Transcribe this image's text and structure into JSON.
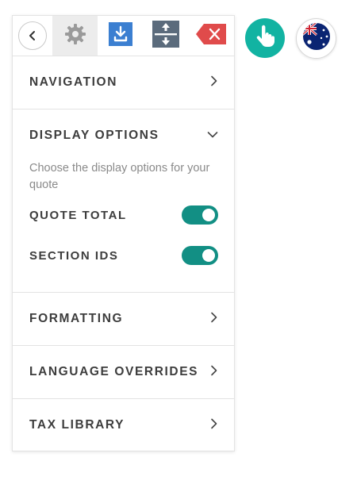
{
  "toolbar": {
    "buttons": [
      {
        "name": "back",
        "icon": "chevron-left-icon"
      },
      {
        "name": "settings",
        "icon": "gear-icon",
        "active": true
      },
      {
        "name": "download",
        "icon": "download-icon",
        "color": "#3b7fd1"
      },
      {
        "name": "expand",
        "icon": "expand-vertical-icon",
        "color": "#5b6b7c"
      },
      {
        "name": "delete",
        "icon": "backspace-icon",
        "color": "#e04b4b"
      }
    ]
  },
  "floating": {
    "interact_icon": "hand-pointer-icon",
    "interact_color": "#12b3a2",
    "locale_icon": "australia-flag-icon"
  },
  "sections": {
    "navigation": {
      "title": "NAVIGATION",
      "state": "collapsed"
    },
    "display_options": {
      "title": "DISPLAY OPTIONS",
      "state": "expanded",
      "description": "Choose the display options for your quote",
      "options": [
        {
          "label": "QUOTE TOTAL",
          "enabled": true
        },
        {
          "label": "SECTION IDS",
          "enabled": true
        }
      ]
    },
    "formatting": {
      "title": "FORMATTING",
      "state": "collapsed"
    },
    "language_overrides": {
      "title": "LANGUAGE OVERRIDES",
      "state": "collapsed"
    },
    "tax_library": {
      "title": "TAX LIBRARY",
      "state": "collapsed"
    }
  },
  "colors": {
    "toggle_on": "#128f84",
    "text_primary": "#3d3d3d",
    "text_muted": "#8a8a8a"
  }
}
